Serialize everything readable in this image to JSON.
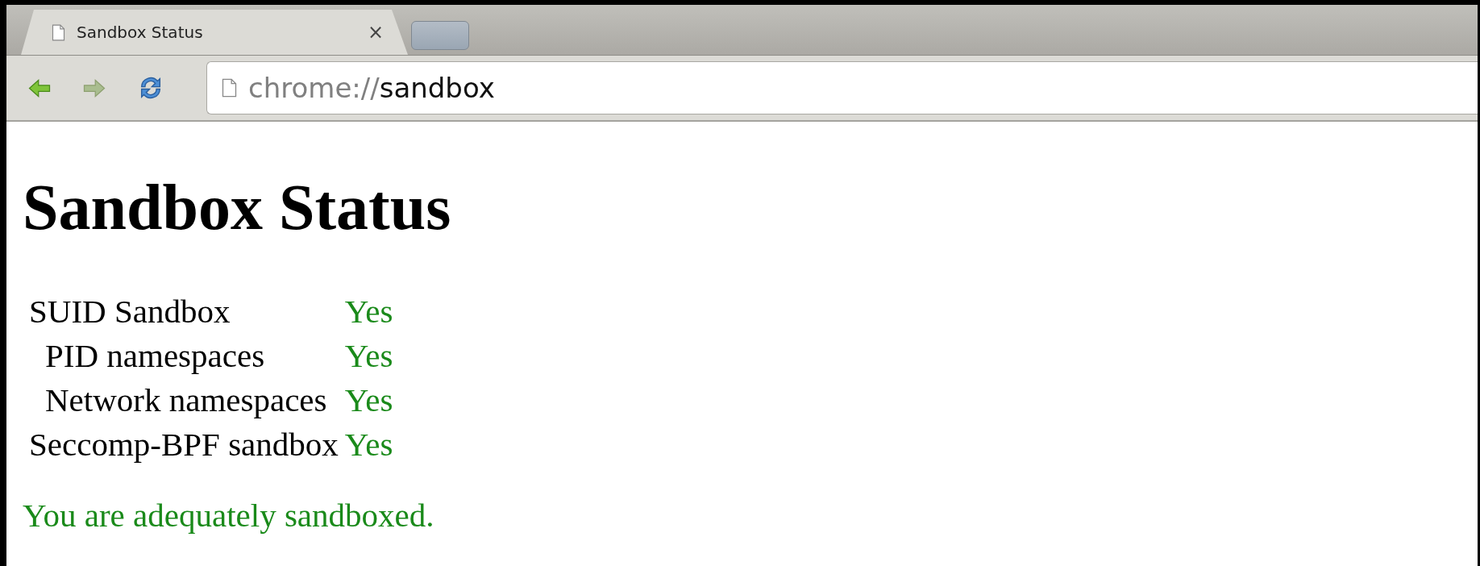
{
  "tabs": [
    {
      "title": "Sandbox Status",
      "selected": true,
      "close": "×"
    },
    {
      "selected": false
    }
  ],
  "address_bar": {
    "scheme": "chrome://",
    "host": "sandbox"
  },
  "page": {
    "heading": "Sandbox Status",
    "rows": [
      {
        "label": "SUID Sandbox",
        "value": "Yes",
        "ok": true,
        "children": [
          {
            "label": "PID namespaces",
            "value": "Yes",
            "ok": true
          },
          {
            "label": "Network namespaces",
            "value": "Yes",
            "ok": true
          }
        ]
      },
      {
        "label": "Seccomp-BPF sandbox",
        "value": "Yes",
        "ok": true
      }
    ],
    "summary": {
      "text": "You are adequately sandboxed.",
      "ok": true
    }
  }
}
